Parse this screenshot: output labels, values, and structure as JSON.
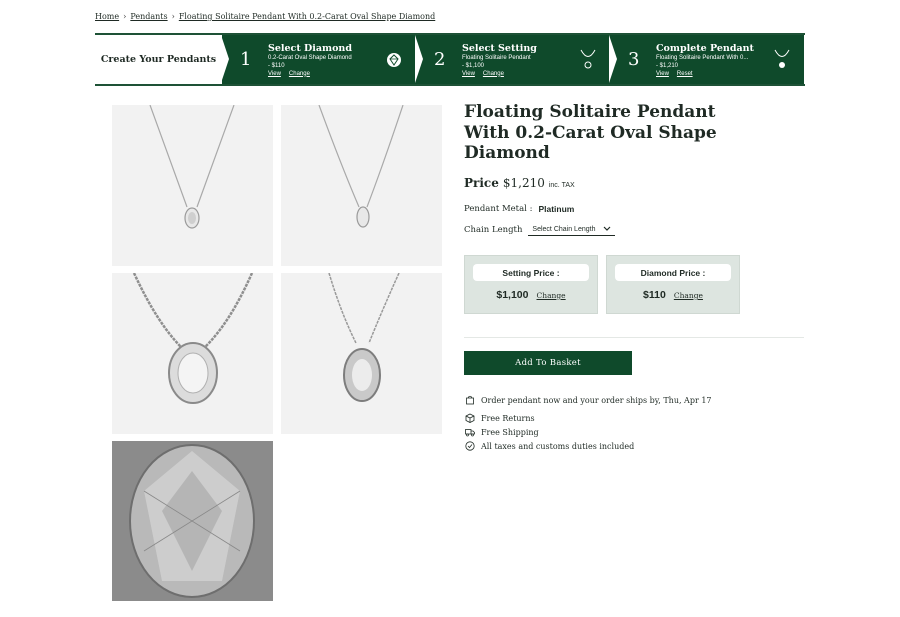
{
  "breadcrumb": {
    "items": [
      "Home",
      "Pendants",
      "Floating Solitaire Pendant With 0.2-Carat Oval Shape Diamond"
    ]
  },
  "steps": {
    "lead": "Create Your Pendants",
    "items": [
      {
        "num": "1",
        "title": "Select Diamond",
        "sub1": "0.2-Carat Oval Shape Diamond",
        "sub2": "- $110",
        "link1": "View",
        "link2": "Change",
        "icon": "diamond-icon"
      },
      {
        "num": "2",
        "title": "Select Setting",
        "sub1": "Floating Solitaire Pendant",
        "sub2": "- $1,100",
        "link1": "View",
        "link2": "Change",
        "icon": "pendant-icon"
      },
      {
        "num": "3",
        "title": "Complete Pendant",
        "sub1": "Floating Solitaire Pendant With 0...",
        "sub2": "- $1,210",
        "link1": "View",
        "link2": "Reset",
        "icon": "pendant-icon"
      }
    ]
  },
  "product": {
    "title": "Floating Solitaire Pendant With 0.2-Carat Oval Shape Diamond",
    "price_label": "Price",
    "price": "$1,210",
    "tax": "inc. TAX",
    "metal_label": "Pendant Metal :",
    "metal_value": "Platinum",
    "chain_label": "Chain Length",
    "chain_select": "Select Chain Length"
  },
  "cards": {
    "setting": {
      "label": "Setting Price :",
      "value": "$1,100",
      "action": "Change"
    },
    "diamond": {
      "label": "Diamond Price :",
      "value": "$110",
      "action": "Change"
    }
  },
  "basket_label": "Add To Basket",
  "perks": {
    "ship": "Order pendant now and your order ships by, Thu, Apr 17",
    "returns": "Free Returns",
    "shipping": "Free Shipping",
    "taxes": "All taxes and customs duties included"
  },
  "colors": {
    "brand": "#0f4a2b",
    "card_bg": "#dde5e0"
  }
}
